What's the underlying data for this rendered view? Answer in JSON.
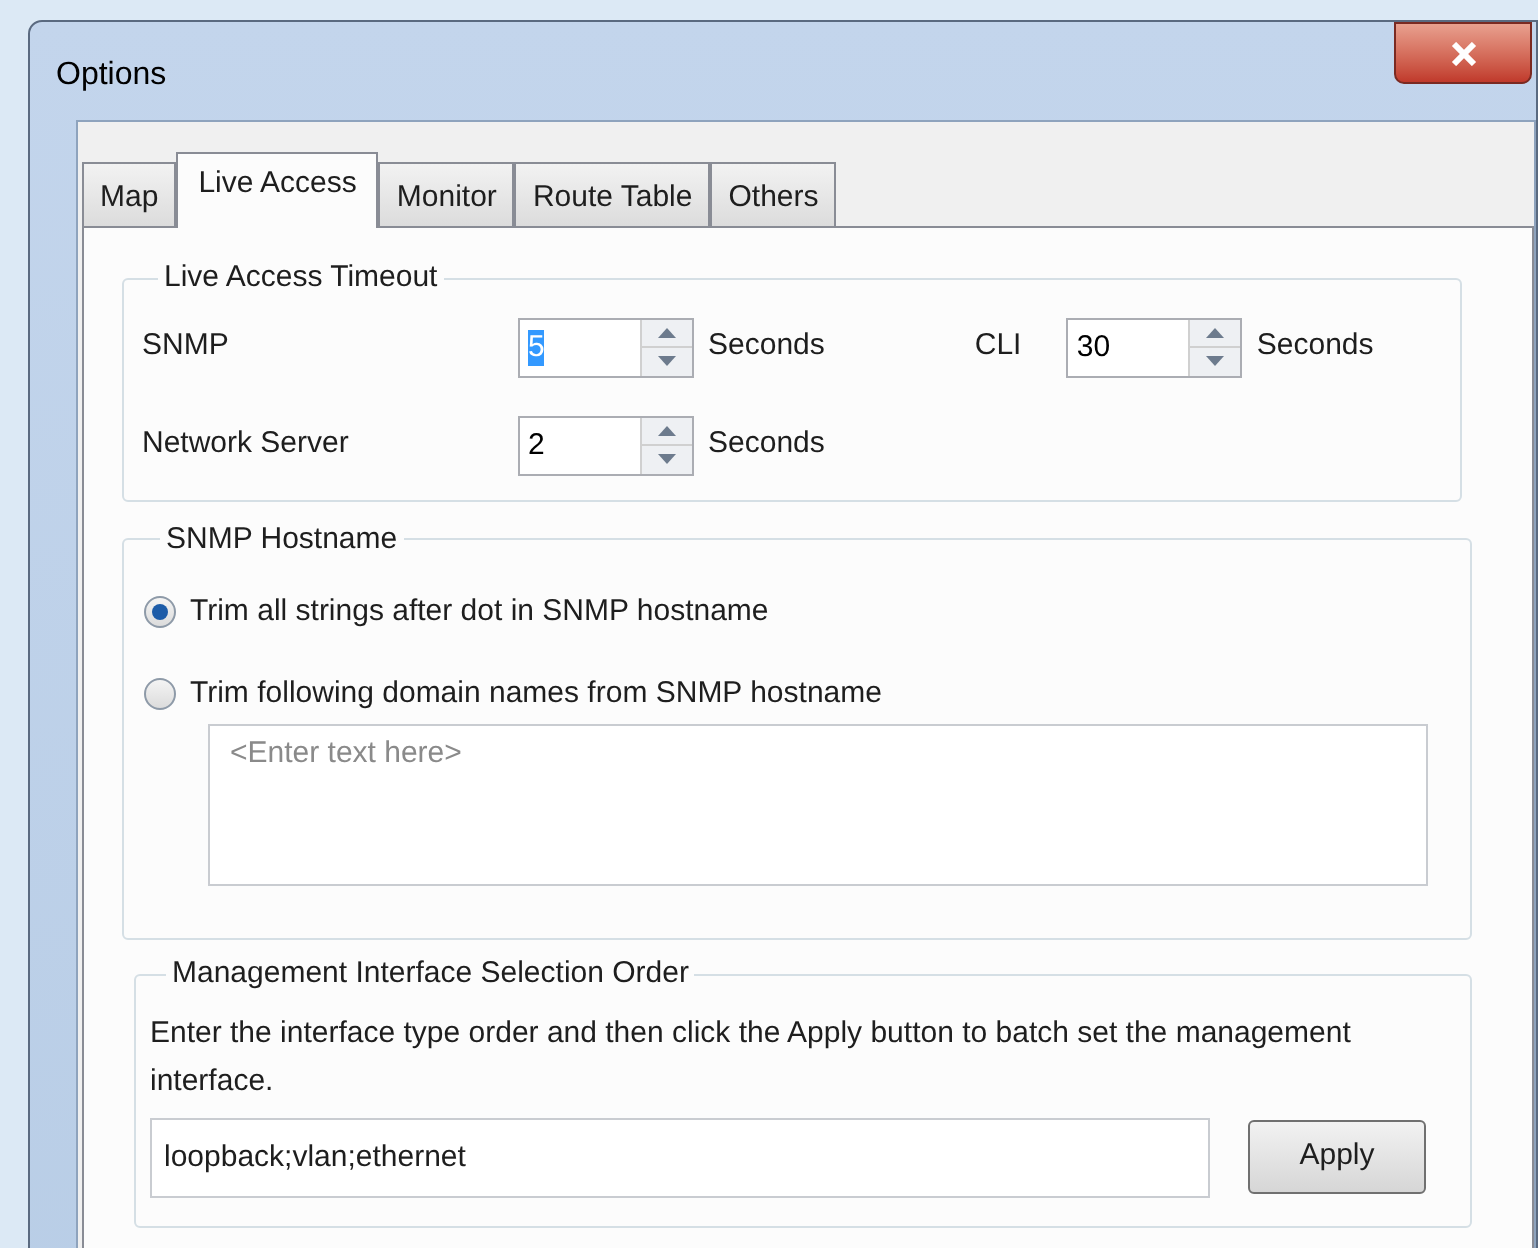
{
  "window": {
    "title": "Options"
  },
  "tabs": [
    {
      "label": "Map",
      "selected": false
    },
    {
      "label": "Live Access",
      "selected": true
    },
    {
      "label": "Monitor",
      "selected": false
    },
    {
      "label": "Route Table",
      "selected": false
    },
    {
      "label": "Others",
      "selected": false
    }
  ],
  "timeout_group": {
    "title": "Live Access Timeout",
    "fields": [
      {
        "label": "SNMP",
        "value": "5",
        "highlighted": true,
        "unit": "Seconds"
      },
      {
        "label": "CLI",
        "value": "30",
        "highlighted": false,
        "unit": "Seconds"
      },
      {
        "label": "Network Server",
        "value": "2",
        "highlighted": false,
        "unit": "Seconds"
      }
    ]
  },
  "hostname_group": {
    "title": "SNMP Hostname",
    "options": [
      {
        "label": "Trim all strings after dot in SNMP hostname",
        "selected": true
      },
      {
        "label": "Trim following domain names from SNMP hostname",
        "selected": false
      }
    ],
    "domain_field": {
      "placeholder": "<Enter text here>"
    }
  },
  "management_group": {
    "title": "Management Interface Selection Order",
    "description": "Enter the interface type order and then  click the Apply button to batch set the management interface.",
    "order_field": {
      "value": "loopback;vlan;ethernet"
    },
    "apply_button": "Apply"
  }
}
